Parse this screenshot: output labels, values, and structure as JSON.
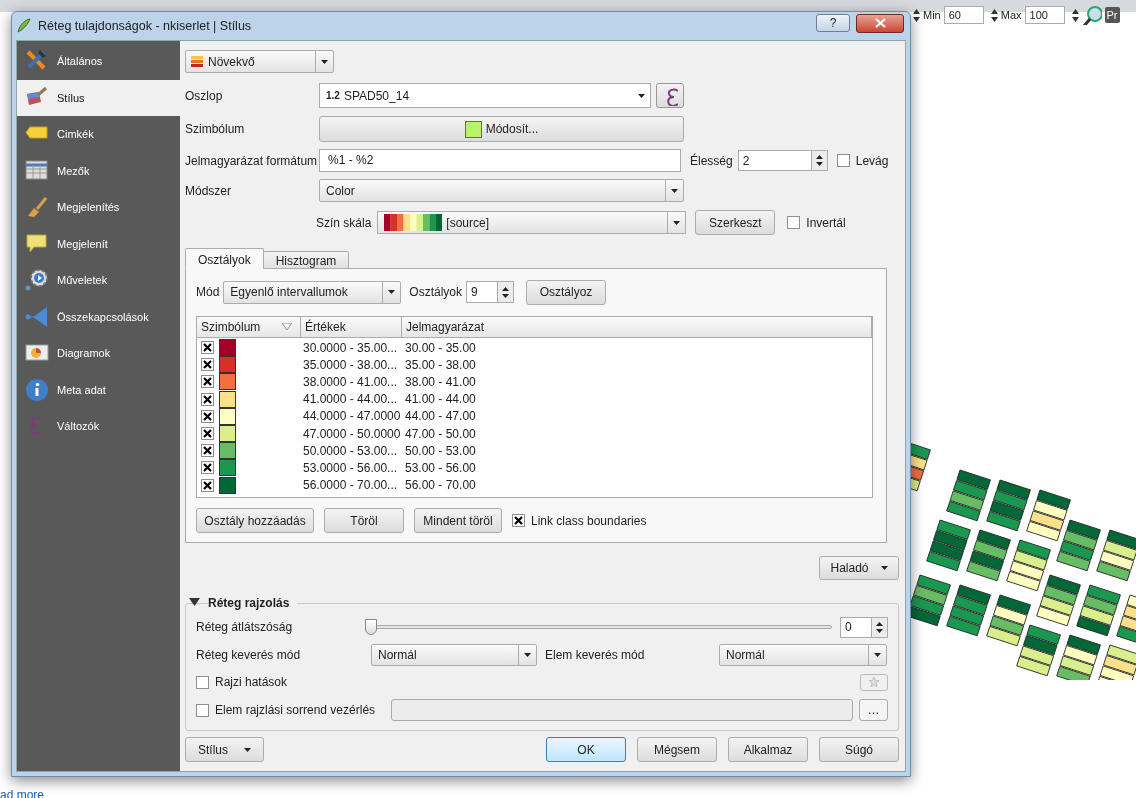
{
  "background_toolbar": {
    "min_label": "Min",
    "min_value": "60",
    "max_label": "Max",
    "max_value": "100",
    "cut_button": "Pr"
  },
  "window": {
    "title": "Réteg tulajdonságok - nkiserlet | Stílus",
    "help_button": "?"
  },
  "sidebar": {
    "items": [
      {
        "label": "Általános",
        "selected": false
      },
      {
        "label": "Stílus",
        "selected": true
      },
      {
        "label": "Cimkék",
        "selected": false
      },
      {
        "label": "Mezők",
        "selected": false
      },
      {
        "label": "Megjelenítés",
        "selected": false
      },
      {
        "label": "Megjelenít",
        "selected": false
      },
      {
        "label": "Műveletek",
        "selected": false
      },
      {
        "label": "Összekapcsolások",
        "selected": false
      },
      {
        "label": "Diagramok",
        "selected": false
      },
      {
        "label": "Meta adat",
        "selected": false
      },
      {
        "label": "Változók",
        "selected": false
      }
    ]
  },
  "renderer": {
    "value": "Növekvő"
  },
  "column": {
    "label": "Oszlop",
    "type_badge": "1.2",
    "value": "SPAD50_14"
  },
  "symbol": {
    "label": "Szimbólum",
    "button": "Módosít..."
  },
  "legend_format": {
    "label": "Jelmagyarázat formátum",
    "value": "%1 - %2",
    "precision_label": "Élesség",
    "precision": "2",
    "trim": {
      "label": "Levág",
      "checked": false
    }
  },
  "method": {
    "label": "Módszer",
    "value": "Color"
  },
  "color_ramp": {
    "label": "Szín skála",
    "value": "[source]",
    "edit_button": "Szerkeszt",
    "invert": {
      "label": "Invertál",
      "checked": false
    }
  },
  "tabs": [
    {
      "label": "Osztályok",
      "selected": true
    },
    {
      "label": "Hisztogram",
      "selected": false
    }
  ],
  "mode": {
    "label": "Mód",
    "value": "Egyenlő intervallumok",
    "classes_label": "Osztályok",
    "classes": "9",
    "classify_button": "Osztályoz"
  },
  "table": {
    "columns": [
      "Szimbólum",
      "Értékek",
      "Jelmagyarázat"
    ],
    "rows": [
      {
        "checked": true,
        "color": "#a50026",
        "values": "30.0000 - 35.00...",
        "legend": "30.00 - 35.00"
      },
      {
        "checked": true,
        "color": "#d73027",
        "values": "35.0000 - 38.00...",
        "legend": "35.00 - 38.00"
      },
      {
        "checked": true,
        "color": "#f46d43",
        "values": "38.0000 - 41.00...",
        "legend": "38.00 - 41.00"
      },
      {
        "checked": true,
        "color": "#fee08b",
        "values": "41.0000 - 44.00...",
        "legend": "41.00 - 44.00"
      },
      {
        "checked": true,
        "color": "#ffffbf",
        "values": "44.0000 - 47.0000",
        "legend": "44.00 - 47.00"
      },
      {
        "checked": true,
        "color": "#d9ef8b",
        "values": "47.0000 - 50.0000",
        "legend": "47.00 - 50.00"
      },
      {
        "checked": true,
        "color": "#66bd63",
        "values": "50.0000 - 53.00...",
        "legend": "50.00 - 53.00"
      },
      {
        "checked": true,
        "color": "#1a9850",
        "values": "53.0000 - 56.00...",
        "legend": "53.00 - 56.00"
      },
      {
        "checked": true,
        "color": "#006837",
        "values": "56.0000 - 70.00...",
        "legend": "56.00 - 70.00"
      }
    ]
  },
  "table_buttons": [
    "Osztály hozzáadás",
    "Töröl",
    "Mindent töröl"
  ],
  "link_boundaries": {
    "label": "Link class boundaries",
    "checked": true
  },
  "advanced_button": "Haladó",
  "layer_rendering": {
    "title": "Réteg rajzolás",
    "expanded": true,
    "transparency": {
      "label": "Réteg átlátszóság",
      "level": 0,
      "value": "0"
    },
    "layer_blend": {
      "label": "Réteg keverés mód",
      "value": "Normál"
    },
    "feature_blend": {
      "label": "Elem keverés mód",
      "value": "Normál"
    },
    "effects": {
      "label": "Rajzi hatások",
      "checked": false
    },
    "order": {
      "label": "Elem rajzlási sorrend vezérlés",
      "checked": false,
      "button": "…"
    }
  },
  "footer": {
    "style_button": "Stílus",
    "buttons": [
      {
        "label": "OK",
        "kind": "default"
      },
      {
        "label": "Mégsem",
        "kind": "normal"
      },
      {
        "label": "Alkalmaz",
        "kind": "normal"
      },
      {
        "label": "Súgó",
        "kind": "normal"
      }
    ]
  },
  "page_link": "ad more"
}
